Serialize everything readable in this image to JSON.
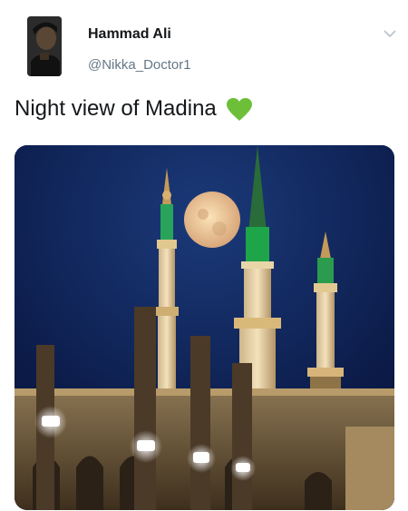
{
  "author": {
    "display_name": "Hammad Ali",
    "handle": "@Nikka_Doctor1"
  },
  "tweet": {
    "text": "Night view of Madina",
    "emoji": "green-heart"
  },
  "colors": {
    "heart": "#6dbf3a",
    "sky": "#0b1d4a",
    "dome": "#1f8a3a",
    "minaret_light": "#f2e6c4",
    "moon": "#f1d2a3"
  }
}
